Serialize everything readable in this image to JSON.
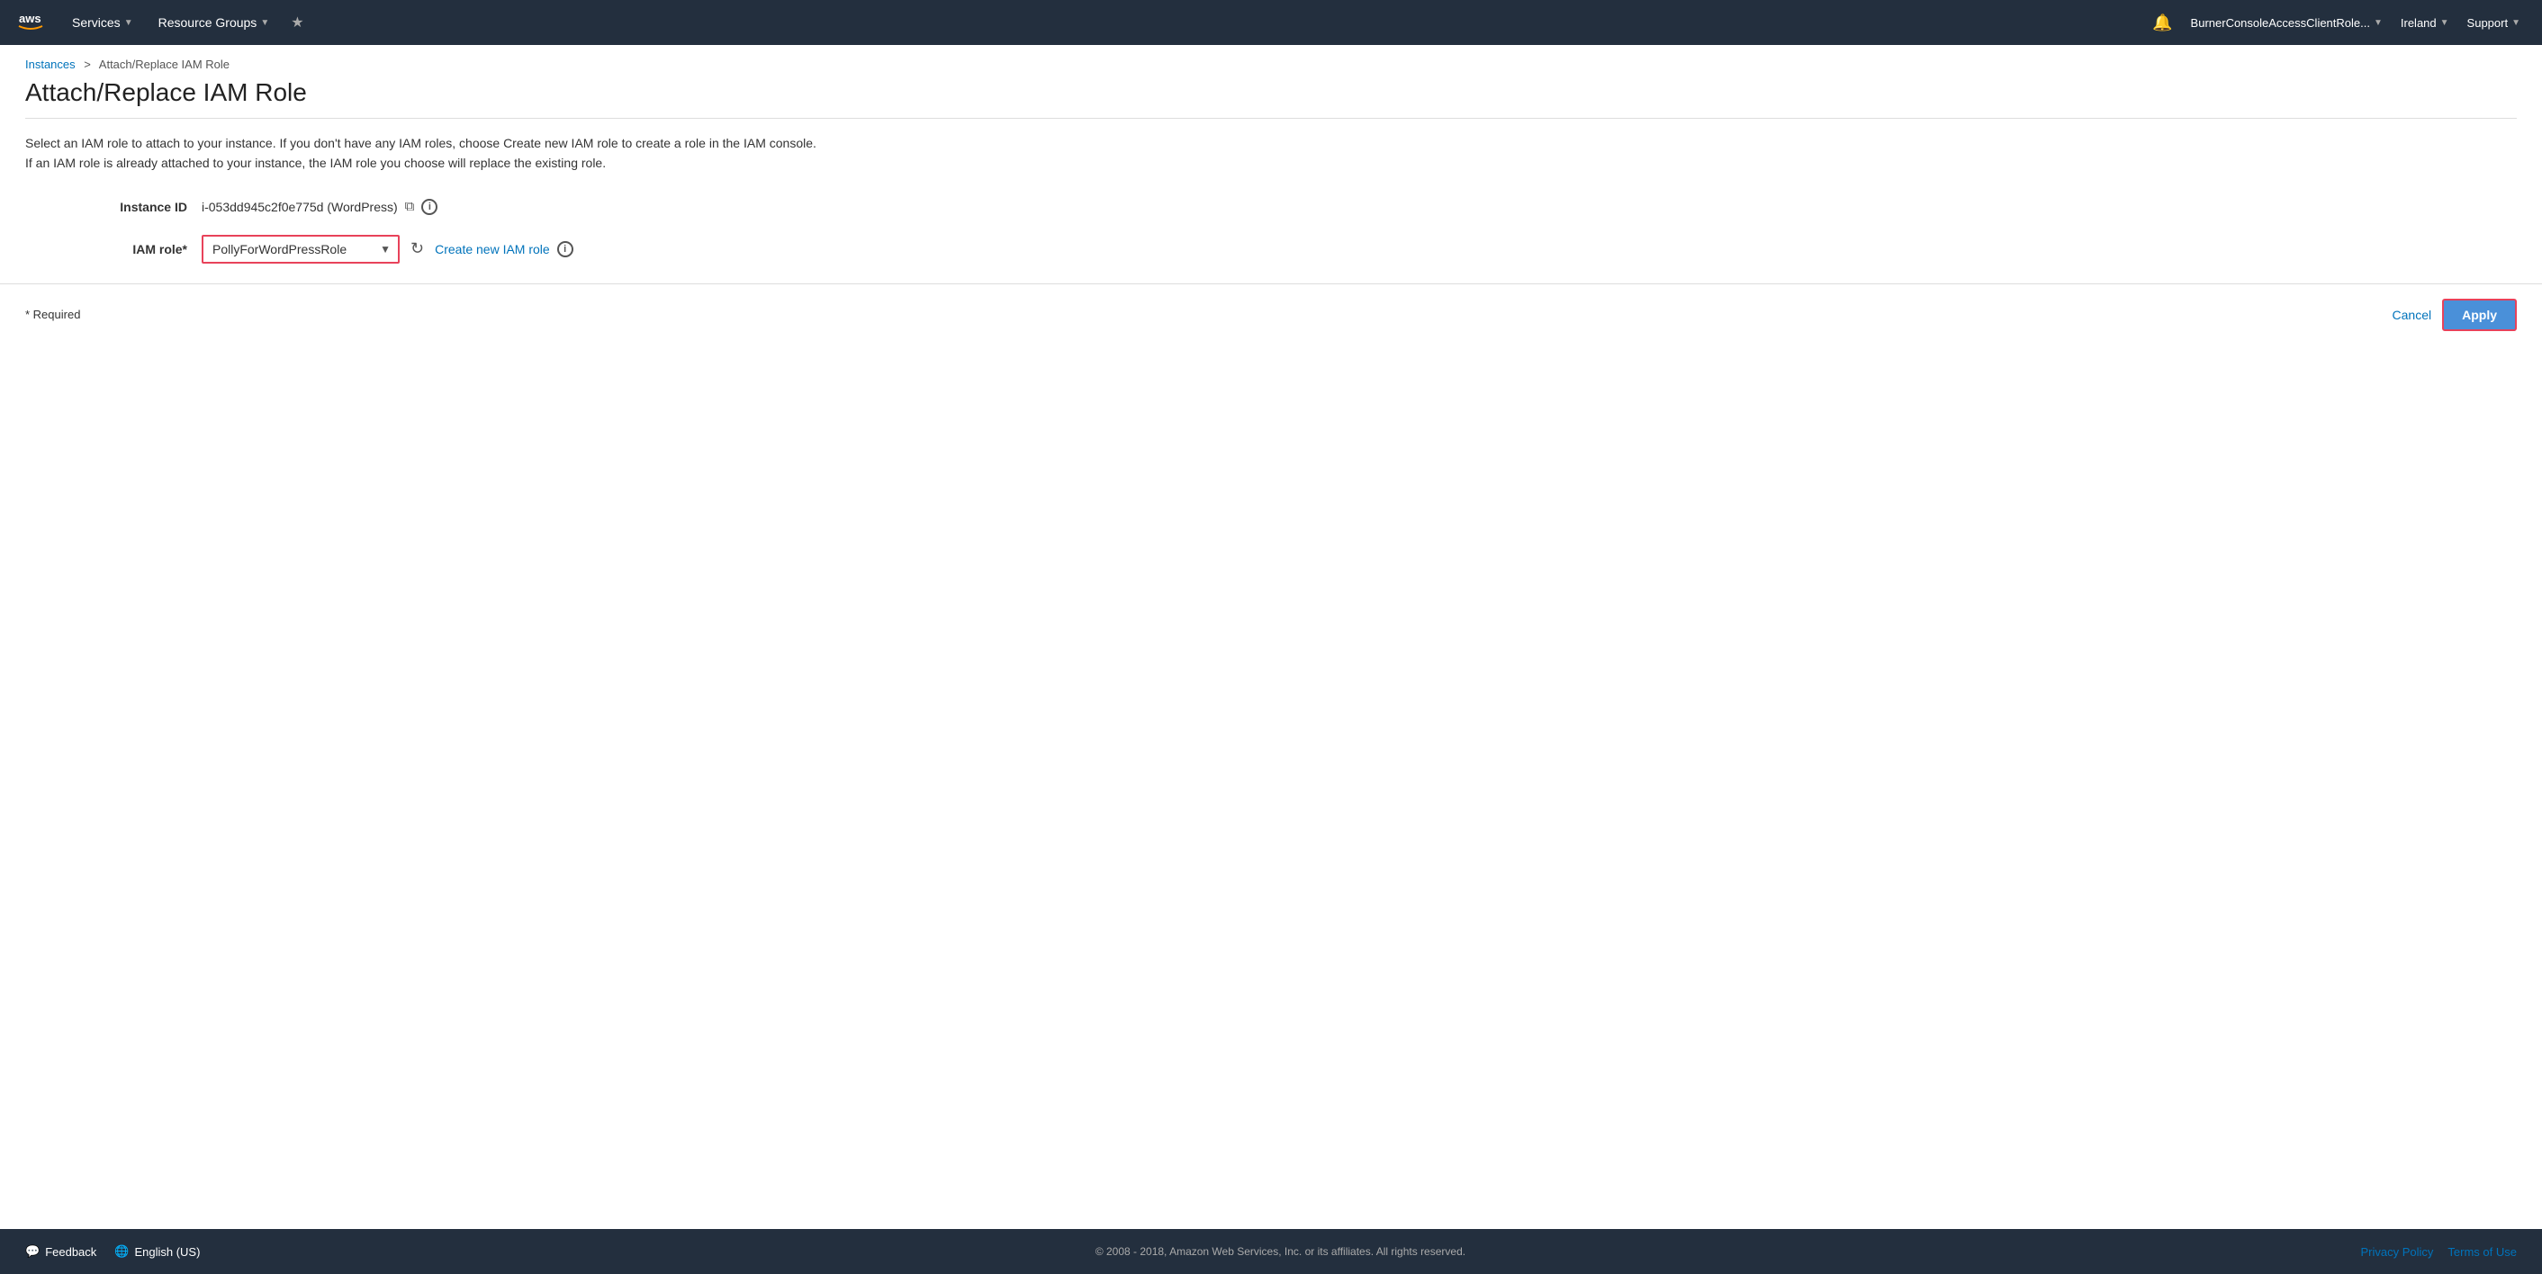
{
  "nav": {
    "services_label": "Services",
    "resource_groups_label": "Resource Groups",
    "bell_icon": "🔔",
    "account_label": "BurnerConsoleAccessClientRole...",
    "region_label": "Ireland",
    "support_label": "Support"
  },
  "breadcrumb": {
    "instances_label": "Instances",
    "separator": ">",
    "current": "Attach/Replace IAM Role"
  },
  "page": {
    "title": "Attach/Replace IAM Role",
    "description_line1": "Select an IAM role to attach to your instance. If you don't have any IAM roles, choose Create new IAM role to create a role in the IAM console.",
    "description_line2": "If an IAM role is already attached to your instance, the IAM role you choose will replace the existing role."
  },
  "form": {
    "instance_id_label": "Instance ID",
    "instance_id_value": "i-053dd945c2f0e775d (WordPress)",
    "iam_role_label": "IAM role*",
    "iam_role_value": "PollyForWordPressRole",
    "create_link_label": "Create new IAM role",
    "required_note": "* Required",
    "cancel_label": "Cancel",
    "apply_label": "Apply"
  },
  "footer": {
    "feedback_label": "Feedback",
    "language_label": "English (US)",
    "copyright": "© 2008 - 2018, Amazon Web Services, Inc. or its affiliates. All rights reserved.",
    "privacy_policy_label": "Privacy Policy",
    "terms_label": "Terms of Use"
  }
}
